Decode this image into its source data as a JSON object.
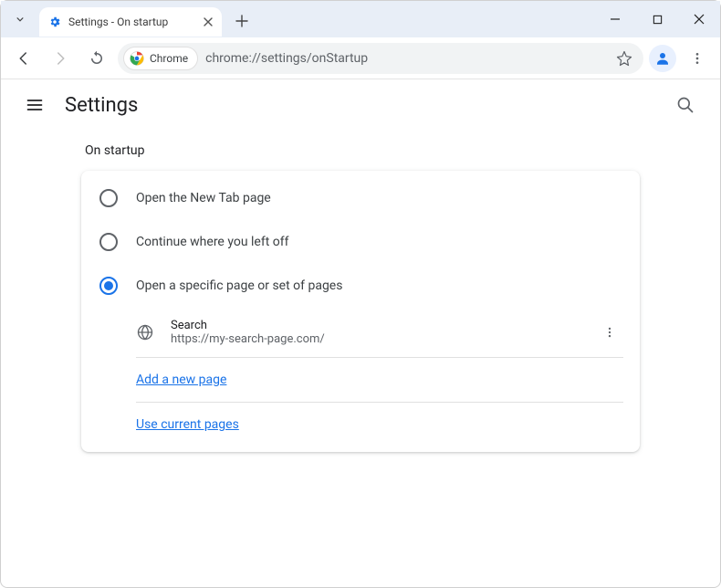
{
  "window": {
    "tab_title": "Settings - On startup",
    "address_chip_label": "Chrome",
    "url": "chrome://settings/onStartup"
  },
  "settings": {
    "header_title": "Settings",
    "section_title": "On startup",
    "options": [
      {
        "label": "Open the New Tab page",
        "selected": false
      },
      {
        "label": "Continue where you left off",
        "selected": false
      },
      {
        "label": "Open a specific page or set of pages",
        "selected": true
      }
    ],
    "startup_pages": [
      {
        "name": "Search",
        "url": "https://my-search-page.com/"
      }
    ],
    "add_page_label": "Add a new page",
    "use_current_label": "Use current pages"
  }
}
